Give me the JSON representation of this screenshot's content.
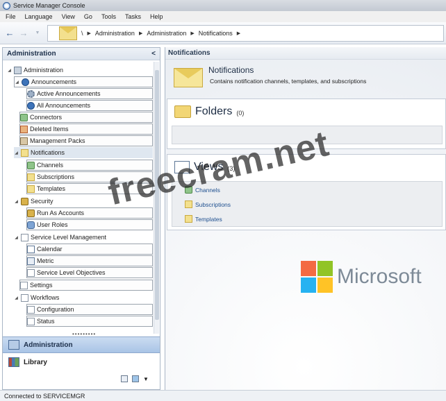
{
  "window": {
    "title": "Service Manager Console"
  },
  "menu": [
    "File",
    "Language",
    "View",
    "Go",
    "Tools",
    "Tasks",
    "Help"
  ],
  "breadcrumb": {
    "root": "\\",
    "items": [
      "Administration",
      "Administration",
      "Notifications"
    ]
  },
  "left_pane": {
    "title": "Administration",
    "collapse_glyph": "<",
    "tree": {
      "administration": "Administration",
      "announcements": "Announcements",
      "active_announcements": "Active Announcements",
      "all_announcements": "All Announcements",
      "connectors": "Connectors",
      "deleted_items": "Deleted Items",
      "management_packs": "Management Packs",
      "notifications": "Notifications",
      "channels": "Channels",
      "subscriptions": "Subscriptions",
      "templates": "Templates",
      "security": "Security",
      "run_as_accounts": "Run As Accounts",
      "user_roles": "User Roles",
      "service_level_management": "Service Level Management",
      "calendar": "Calendar",
      "metric": "Metric",
      "service_level_objectives": "Service Level Objectives",
      "settings": "Settings",
      "workflows": "Workflows",
      "configuration": "Configuration",
      "status": "Status"
    },
    "workspaces": {
      "administration": "Administration",
      "library": "Library"
    }
  },
  "right_pane": {
    "title": "Notifications",
    "heading": "Notifications",
    "description": "Contains notification channels, templates, and subscriptions",
    "folders": {
      "title": "Folders",
      "count": "(0)"
    },
    "views": {
      "title": "Views",
      "count": "(3)",
      "items": [
        "Channels",
        "Subscriptions",
        "Templates"
      ]
    },
    "logo": "Microsoft"
  },
  "status_bar": "Connected to SERVICEMGR",
  "watermark": "freecram.net",
  "colors": {
    "accent": "#a9c4e6",
    "ms_red": "#f25022",
    "ms_green": "#7fba00",
    "ms_blue": "#00a4ef",
    "ms_yellow": "#ffb900"
  }
}
